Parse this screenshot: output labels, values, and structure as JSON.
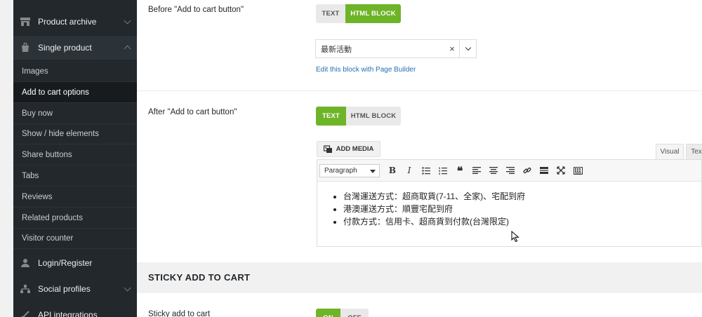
{
  "sidebar": {
    "top_items": [
      {
        "label": "Product archive",
        "icon": "store-icon"
      },
      {
        "label": "Single product",
        "icon": "bag-icon"
      }
    ],
    "sub_items": [
      {
        "label": "Images"
      },
      {
        "label": "Add to cart options"
      },
      {
        "label": "Buy now"
      },
      {
        "label": "Show / hide elements"
      },
      {
        "label": "Share buttons"
      },
      {
        "label": "Tabs"
      },
      {
        "label": "Reviews"
      },
      {
        "label": "Related products"
      },
      {
        "label": "Visitor counter"
      }
    ],
    "bottom_items": [
      {
        "label": "Login/Register",
        "icon": "user-icon"
      },
      {
        "label": "Social profiles",
        "icon": "network-icon"
      },
      {
        "label": "API integrations",
        "icon": "api-icon"
      }
    ]
  },
  "before": {
    "label": "Before \"Add to cart button\"",
    "options": [
      "TEXT",
      "HTML BLOCK"
    ],
    "selected": "HTML BLOCK",
    "select_value": "最新活動",
    "edit_link": "Edit this block with Page Builder"
  },
  "after": {
    "label": "After \"Add to cart button\"",
    "options": [
      "TEXT",
      "HTML BLOCK"
    ],
    "selected": "TEXT",
    "add_media": "ADD MEDIA",
    "tab_visual": "Visual",
    "tab_text": "Tex",
    "format_select": "Paragraph",
    "content": [
      "台灣運送方式：超商取貨(7-11、全家)、宅配到府",
      "港澳運送方式：順豐宅配到府",
      "付款方式：信用卡、超商貨到付款(台灣限定)"
    ]
  },
  "sticky": {
    "section_title": "STICKY ADD TO CART",
    "label": "Sticky add to cart",
    "options": [
      "ON",
      "OFF"
    ],
    "selected": "ON"
  },
  "colors": {
    "accent": "#6eb428",
    "sidebar_bg": "#23282d",
    "link": "#2271b1"
  }
}
